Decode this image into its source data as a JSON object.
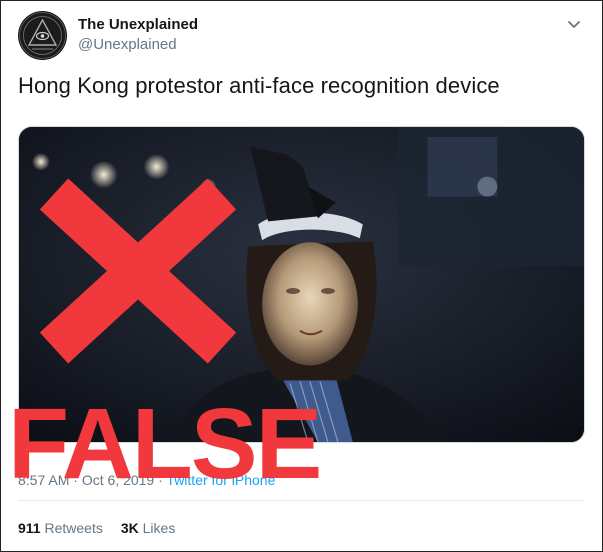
{
  "account": {
    "name": "The Unexplained",
    "handle": "@Unexplained",
    "avatar_icon": "pyramid-eye-icon"
  },
  "tweet": {
    "text": "Hong Kong protestor anti-face recognition device",
    "time": "8:57 AM",
    "separator": " · ",
    "date": "Oct 6, 2019",
    "client": "Twitter for iPhone"
  },
  "stats": {
    "retweets_count": "911",
    "retweets_label": "Retweets",
    "likes_count": "3K",
    "likes_label": "Likes"
  },
  "overlay": {
    "verdict": "FALSE",
    "x_color": "#f0383d",
    "icon": "x-mark-icon"
  },
  "colors": {
    "link": "#1da1f2",
    "muted": "#657786",
    "text": "#14171a"
  }
}
